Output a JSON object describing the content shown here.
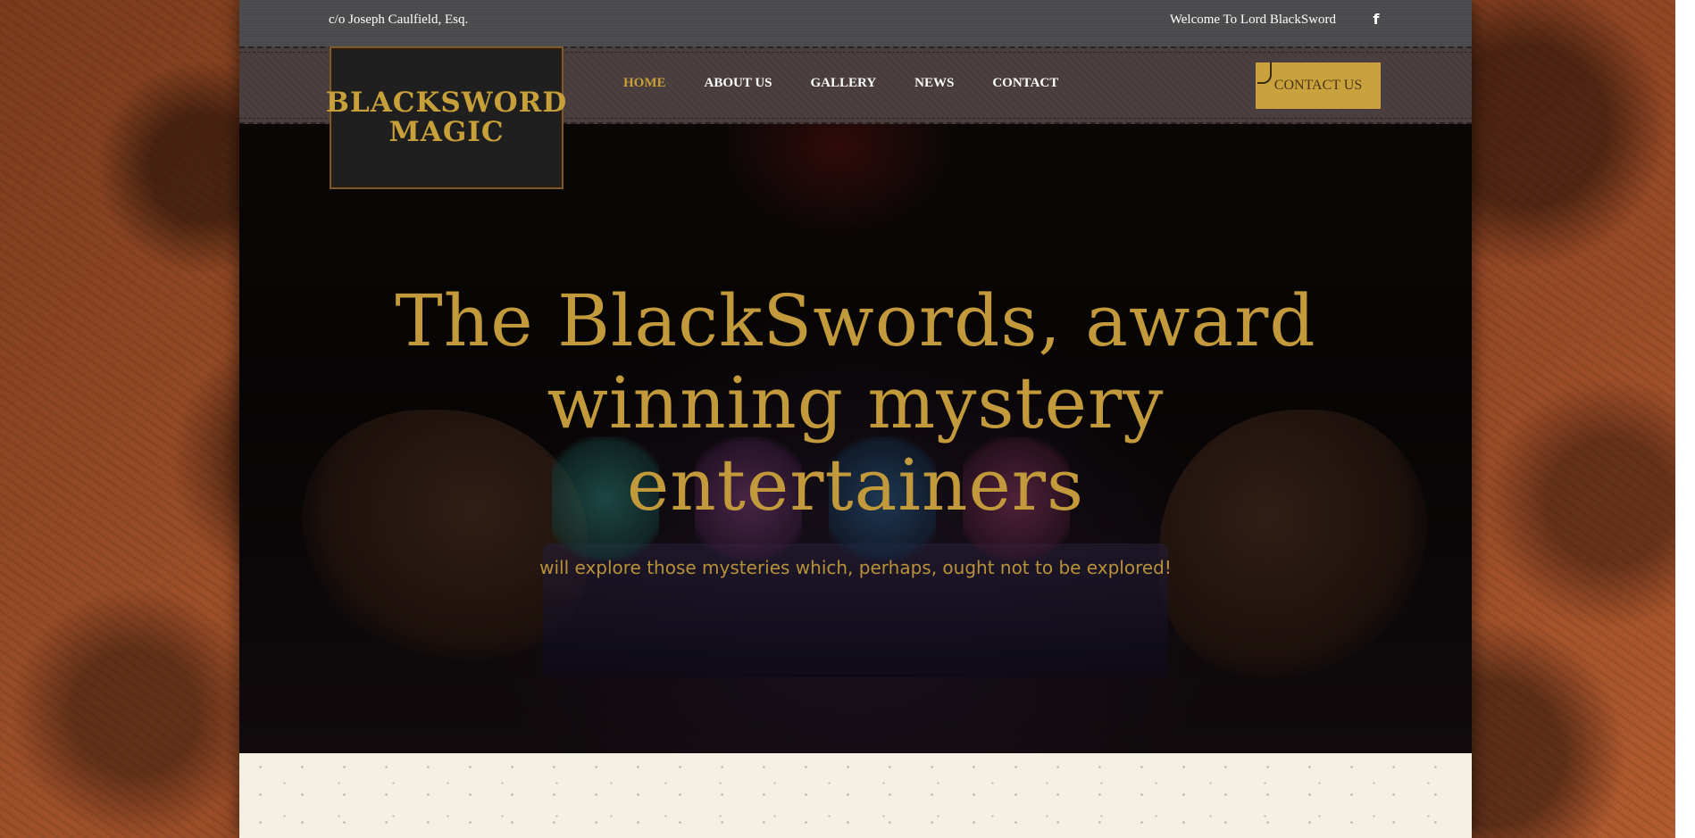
{
  "topbar": {
    "address": "c/o Joseph Caulfield, Esq.",
    "welcome": "Welcome To Lord BlackSword",
    "facebook_icon_glyph": "f"
  },
  "logo": {
    "line1": "BLACKSWORD",
    "line2": "MAGIC"
  },
  "nav": {
    "items": [
      {
        "label": "HOME",
        "active": true
      },
      {
        "label": "ABOUT US",
        "active": false
      },
      {
        "label": "GALLERY",
        "active": false
      },
      {
        "label": "NEWS",
        "active": false
      },
      {
        "label": "CONTACT",
        "active": false
      }
    ],
    "cta_label": "CONTACT US"
  },
  "hero": {
    "title_line1": "The BlackSwords, award",
    "title_line2": "winning mystery",
    "title_line3": "entertainers",
    "subtitle": "will explore those mysteries which, perhaps, ought not to be explored!"
  },
  "colors": {
    "gold": "#c29a3c",
    "cta_bg": "#c9a23d",
    "topbar_bg": "#4a4a4c",
    "navbar_bg": "#4b3f3f"
  }
}
